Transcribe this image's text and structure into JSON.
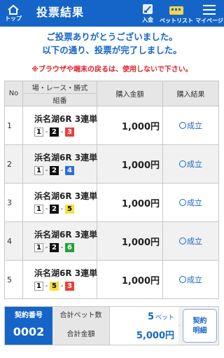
{
  "header": {
    "title": "投票結果",
    "nav": {
      "home_label": "トップ",
      "deposit_label": "入金",
      "betlist_label": "ベットリスト",
      "mypage_label": "マイページ"
    },
    "colors": {
      "background": "#1565c8",
      "text": "#ffffff"
    },
    "icons": [
      "home-icon",
      "deposit-icon",
      "betlist-icon",
      "menu-icon"
    ]
  },
  "messages": {
    "line1": "ご投票ありがとうございました。",
    "line2": "以下の通り、投票が完了しました。",
    "warning": "※ブラウザや端末の戻るは、使用しないで下さい。"
  },
  "table": {
    "headers": {
      "no": "No",
      "race_top": "場・レース・勝式",
      "race_bottom": "組番",
      "amount": "購入金額",
      "result": "購入結果"
    },
    "rows": [
      {
        "no": "1",
        "race": "浜名湖6R 3連単",
        "combo": [
          "1",
          "2",
          "3"
        ],
        "amount": "1,000円",
        "result": "成立"
      },
      {
        "no": "2",
        "race": "浜名湖6R 3連単",
        "combo": [
          "1",
          "2",
          "4"
        ],
        "amount": "1,000円",
        "result": "成立"
      },
      {
        "no": "3",
        "race": "浜名湖6R 3連単",
        "combo": [
          "1",
          "2",
          "5"
        ],
        "amount": "1,000円",
        "result": "成立"
      },
      {
        "no": "4",
        "race": "浜名湖6R 3連単",
        "combo": [
          "1",
          "2",
          "6"
        ],
        "amount": "1,000円",
        "result": "成立"
      },
      {
        "no": "5",
        "race": "浜名湖6R 3連単",
        "combo": [
          "1",
          "5",
          "3"
        ],
        "amount": "1,000円",
        "result": "成立"
      }
    ],
    "combo_separator": "-"
  },
  "summary": {
    "contract_no_label": "契約番号",
    "contract_no": "0002",
    "bet_count_label": "合計ベット数",
    "bet_count": "5",
    "bet_count_unit": "ベット",
    "total_label": "合計金額",
    "total": "5,000円",
    "contract_button_line1": "契約",
    "contract_button_line2": "明細"
  },
  "boat_colors": {
    "1": "#ffffff",
    "2": "#111111",
    "3": "#e8413c",
    "4": "#2a6fdb",
    "5": "#f4e03a",
    "6": "#22a23a"
  },
  "accent_color": "#1565c8",
  "warning_color": "#e0202a"
}
